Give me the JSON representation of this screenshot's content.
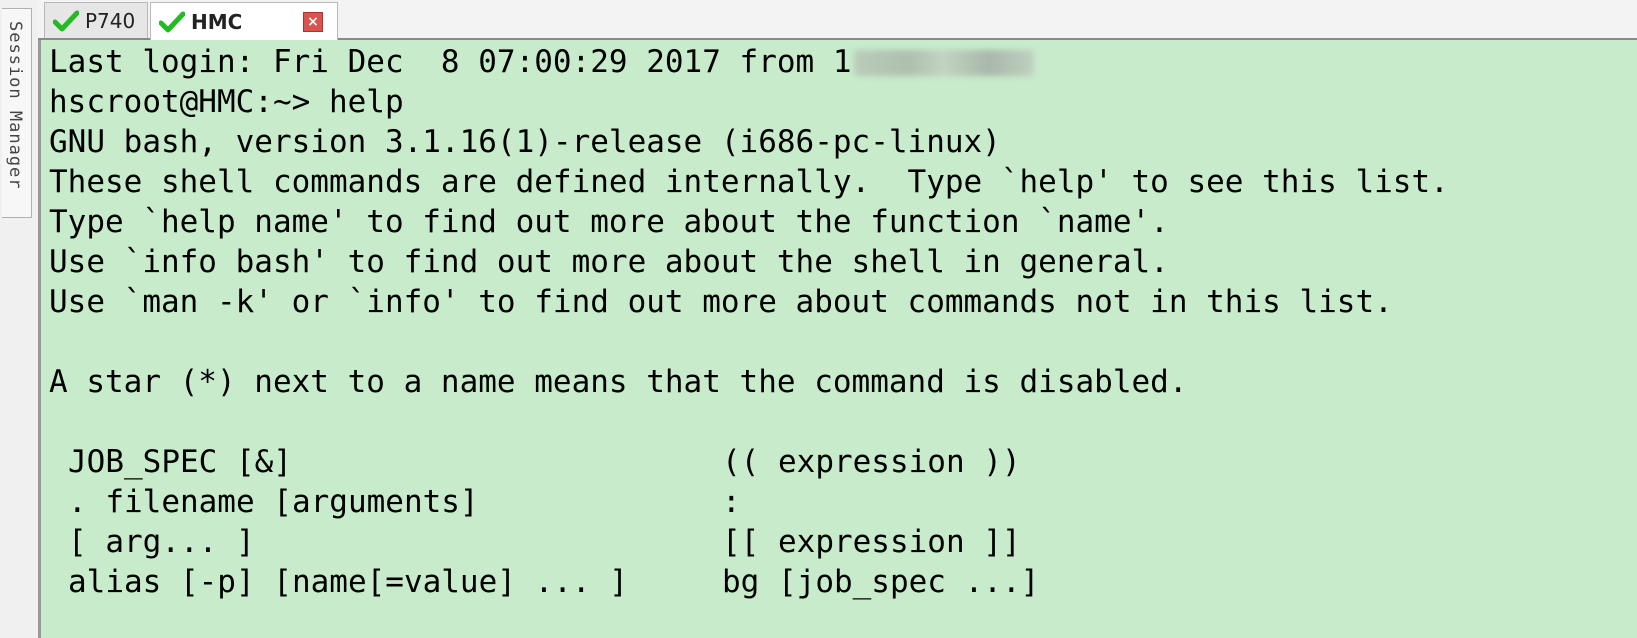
{
  "side_panel": {
    "label": "Session Manager"
  },
  "tabs": [
    {
      "label": "P740",
      "active": false,
      "status_icon": "check-icon"
    },
    {
      "label": "HMC",
      "active": true,
      "status_icon": "check-icon",
      "close_icon": "close-icon"
    }
  ],
  "terminal": {
    "background": "#c8ebcc",
    "lines": [
      "Last login: Fri Dec  8 07:00:29 2017 from 1",
      "hscroot@HMC:~> help",
      "GNU bash, version 3.1.16(1)-release (i686-pc-linux)",
      "These shell commands are defined internally.  Type `help' to see this list.",
      "Type `help name' to find out more about the function `name'.",
      "Use `info bash' to find out more about the shell in general.",
      "Use `man -k' or `info' to find out more about commands not in this list.",
      "",
      "A star (*) next to a name means that the command is disabled."
    ],
    "command_table": [
      {
        "left": "JOB_SPEC [&]",
        "right": "(( expression ))"
      },
      {
        "left": ". filename [arguments]",
        "right": ":"
      },
      {
        "left": "[ arg... ]",
        "right": "[[ expression ]]"
      },
      {
        "left": "alias [-p] [name[=value] ... ]",
        "right": "bg [job_spec ...]"
      }
    ]
  },
  "colors": {
    "check": "#22bb22",
    "close": "#d9534f",
    "terminal_bg": "#c8ebcc"
  }
}
